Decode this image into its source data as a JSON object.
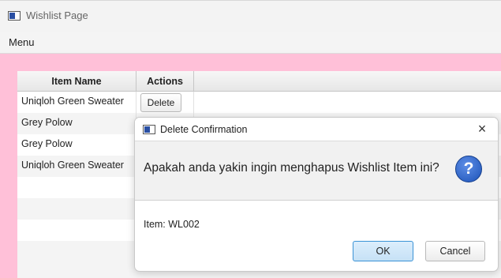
{
  "window": {
    "title": "Wishlist Page",
    "icon": "app-window-icon"
  },
  "menubar": {
    "items": [
      "Menu"
    ]
  },
  "table": {
    "columns": [
      "Item Name",
      "Actions"
    ],
    "rows": [
      {
        "name": "Uniqloh Green Sweater",
        "action": "Delete"
      },
      {
        "name": "Grey Polow",
        "action": ""
      },
      {
        "name": "Grey Polow",
        "action": ""
      },
      {
        "name": "Uniqloh Green Sweater",
        "action": ""
      },
      {
        "name": "",
        "action": ""
      },
      {
        "name": "",
        "action": ""
      },
      {
        "name": "",
        "action": ""
      },
      {
        "name": "",
        "action": ""
      }
    ]
  },
  "dialog": {
    "title": "Delete Confirmation",
    "close_symbol": "×",
    "message": "Apakah anda yakin ingin menghapus Wishlist Item ini?",
    "icon_symbol": "?",
    "content": "Item: WL002",
    "ok_label": "OK",
    "cancel_label": "Cancel"
  },
  "colors": {
    "accent_pink": "#ffc0d8",
    "ok_border": "#3b93d6",
    "question_blue": "#1b52b8"
  }
}
